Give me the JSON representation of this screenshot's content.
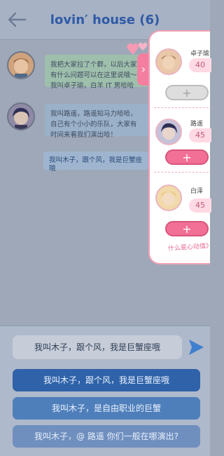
{
  "header": {
    "title": "lovin′ house (6)",
    "back_icon": "arrow-left-icon"
  },
  "messages": [
    {
      "text": "我把大家拉了个群，以后大家有什么问题可以在这里说哦～我叫卓子瑜，白羊 IT 男哈哈",
      "avatar_icon": "user-avatar-icon"
    },
    {
      "text": "我叫路遥，路遥知马力哈哈，自己有个小小的乐队，大家有时间来看我们演出哈！",
      "avatar_icon": "user-avatar-icon"
    },
    {
      "text": "我叫木子，跟个风，我是巨蟹座哦"
    }
  ],
  "panel": {
    "characters": [
      {
        "name": "卓子瑜",
        "score": "40",
        "plus": "+",
        "enabled": false
      },
      {
        "name": "路遥",
        "score": "45",
        "plus": "+",
        "enabled": true
      },
      {
        "name": "白泽",
        "score": "45",
        "plus": "+",
        "enabled": true
      }
    ],
    "link_text": "什么是心动值》"
  },
  "input": {
    "value": "我叫木子，跟个风，我是巨蟹座哦"
  },
  "options": [
    "我叫木子，跟个风，我是巨蟹座哦",
    "我叫木子，是自由职业的巨蟹",
    "我叫木子，@ 路遥 你们一般在哪演出?"
  ],
  "colors": {
    "accent_blue": "#2f62a8",
    "accent_pink": "#f26f95"
  }
}
